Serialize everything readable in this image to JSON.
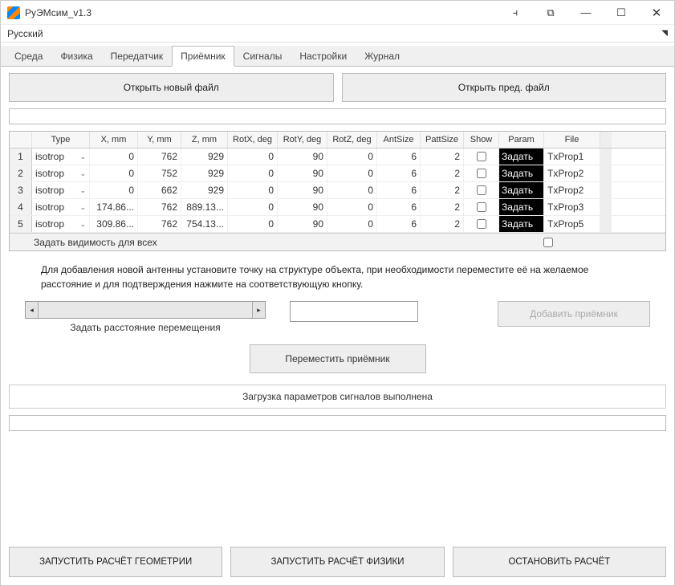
{
  "window": {
    "title": "РуЭМсим_v1.3"
  },
  "menu": {
    "lang": "Русский"
  },
  "tabs": [
    "Среда",
    "Физика",
    "Передатчик",
    "Приёмник",
    "Сигналы",
    "Настройки",
    "Журнал"
  ],
  "activeTab": 3,
  "buttons": {
    "open_new": "Открыть новый файл",
    "open_prev": "Открыть пред. файл",
    "add_rx": "Добавить приёмник",
    "move_rx": "Переместить приёмник",
    "run_geom": "ЗАПУСТИТЬ РАСЧЁТ ГЕОМЕТРИИ",
    "run_phys": "ЗАПУСТИТЬ РАСЧЁТ ФИЗИКИ",
    "stop": "ОСТАНОВИТЬ РАСЧЁТ"
  },
  "table": {
    "headers": [
      "",
      "Type",
      "X, mm",
      "Y, mm",
      "Z, mm",
      "RotX, deg",
      "RotY, deg",
      "RotZ, deg",
      "AntSize",
      "PattSize",
      "Show",
      "Param",
      "File",
      ""
    ],
    "param_label": "Задать",
    "rows": [
      {
        "idx": "1",
        "type": "isotrop",
        "x": "0",
        "y": "762",
        "z": "929",
        "rx": "0",
        "ry": "90",
        "rz": "0",
        "ant": "6",
        "patt": "2",
        "file": "TxProp1"
      },
      {
        "idx": "2",
        "type": "isotrop",
        "x": "0",
        "y": "752",
        "z": "929",
        "rx": "0",
        "ry": "90",
        "rz": "0",
        "ant": "6",
        "patt": "2",
        "file": "TxProp2"
      },
      {
        "idx": "3",
        "type": "isotrop",
        "x": "0",
        "y": "662",
        "z": "929",
        "rx": "0",
        "ry": "90",
        "rz": "0",
        "ant": "6",
        "patt": "2",
        "file": "TxProp2"
      },
      {
        "idx": "4",
        "type": "isotrop",
        "x": "174.86...",
        "y": "762",
        "z": "889.13...",
        "rx": "0",
        "ry": "90",
        "rz": "0",
        "ant": "6",
        "patt": "2",
        "file": "TxProp3"
      },
      {
        "idx": "5",
        "type": "isotrop",
        "x": "309.86...",
        "y": "762",
        "z": "754.13...",
        "rx": "0",
        "ry": "90",
        "rz": "0",
        "ant": "6",
        "patt": "2",
        "file": "TxProp5"
      }
    ],
    "vis_all": "Задать видимость для всех"
  },
  "help": "Для добавления новой антенны установите точку на структуре объекта, при необходимости переместите её на желаемое расстояние и для подтверждения нажмите на соответствующую кнопку.",
  "slider_label": "Задать расстояние перемещения",
  "status": "Загрузка параметров сигналов выполнена"
}
